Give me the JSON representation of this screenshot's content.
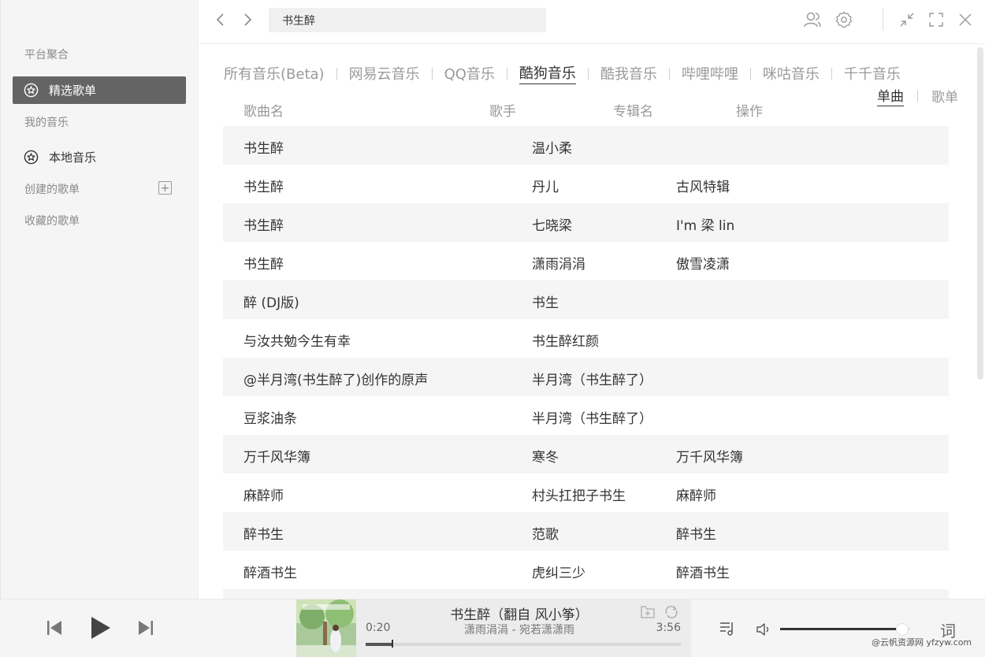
{
  "sidebar": {
    "section_platform": "平台聚合",
    "selected_playlists": "精选歌单",
    "section_my_music": "我的音乐",
    "local_music": "本地音乐",
    "created_playlists": "创建的歌单",
    "add_symbol": "+",
    "collected_playlists": "收藏的歌单"
  },
  "search": {
    "value": "书生醉"
  },
  "platform_tabs": [
    {
      "label": "所有音乐(Beta)",
      "active": false
    },
    {
      "label": "网易云音乐",
      "active": false
    },
    {
      "label": "QQ音乐",
      "active": false
    },
    {
      "label": "酷狗音乐",
      "active": true
    },
    {
      "label": "酷我音乐",
      "active": false
    },
    {
      "label": "哔哩哔哩",
      "active": false
    },
    {
      "label": "咪咕音乐",
      "active": false
    },
    {
      "label": "千千音乐",
      "active": false
    }
  ],
  "type_tabs": {
    "single": "单曲",
    "playlist": "歌单",
    "active": "single"
  },
  "table": {
    "headers": {
      "name": "歌曲名",
      "artist": "歌手",
      "album": "专辑名",
      "action": "操作"
    },
    "rows": [
      {
        "name": "书生醉",
        "artist": "温小柔",
        "album": ""
      },
      {
        "name": "书生醉",
        "artist": "丹儿",
        "album": "古风特辑"
      },
      {
        "name": "书生醉",
        "artist": "七晓梁",
        "album": "I'm 梁 lin"
      },
      {
        "name": "书生醉",
        "artist": "潇雨涓涓",
        "album": "傲雪凌潇"
      },
      {
        "name": "醉 (DJ版)",
        "artist": "书生",
        "album": ""
      },
      {
        "name": "与汝共勉今生有幸",
        "artist": "书生醉红颜",
        "album": ""
      },
      {
        "name": "@半月湾(书生醉了)创作的原声",
        "artist": "半月湾（书生醉了）",
        "album": ""
      },
      {
        "name": "豆浆油条",
        "artist": "半月湾（书生醉了）",
        "album": ""
      },
      {
        "name": "万千风华簿",
        "artist": "寒冬",
        "album": "万千风华簿"
      },
      {
        "name": "麻醉师",
        "artist": "村头扛把子书生",
        "album": "麻醉师"
      },
      {
        "name": "醉书生",
        "artist": "范歌",
        "album": "醉书生"
      },
      {
        "name": "醉酒书生",
        "artist": "虎纠三少",
        "album": "醉酒书生"
      },
      {
        "name": "",
        "artist": "",
        "album": ""
      }
    ]
  },
  "player": {
    "title": "书生醉（翻自 风小筝）",
    "subtitle": "潇雨涓涓 - 宛若潇潇雨",
    "current_time": "0:20",
    "total_time": "3:56",
    "progress": 0.085,
    "volume": 0.94,
    "lyric_label": "词"
  },
  "watermark": "@云帆资源网 yfzyw.com",
  "colors": {
    "active_item_bg": "#646464",
    "row_alt_bg": "#f5f5f5",
    "player_bg": "#f5f5f5"
  }
}
